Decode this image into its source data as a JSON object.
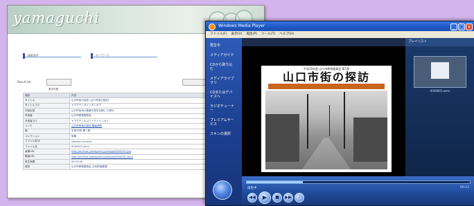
{
  "web_page": {
    "logo_text": "yamaguchi",
    "top_right_note": "データ検索",
    "field_a_label": "検索条件",
    "field_b_label": "キーワード",
    "list_label": "Result list",
    "select_value": "表示件数",
    "rows": [
      {
        "key": "項目",
        "value": "内容",
        "link": false
      },
      {
        "key": "タイトル",
        "value": "山口市街の採訪 (山口市街の探訪)",
        "link": false
      },
      {
        "key": "タイトルヨミ",
        "value": "ヤマグチシガイノタンボウ",
        "link": false
      },
      {
        "key": "内容記述",
        "value": "山口市街地の風景写真を収録した資料",
        "link": false
      },
      {
        "key": "作成者",
        "value": "山口市教育委員会",
        "link": false
      },
      {
        "key": "作成者ヨミ",
        "value": "ヤマグチシキョウイクイインカイ",
        "link": false
      },
      {
        "key": "リンク",
        "value": "山口市街地の探訪 動画資料",
        "link": true
      },
      {
        "key": "版",
        "value": "平成16年 第一版",
        "link": false
      },
      {
        "key": "コレクション",
        "value": "映像",
        "link": false
      },
      {
        "key": "ファイル形式",
        "value": "video/x-ms-wmv",
        "link": false
      },
      {
        "key": "ファイル名",
        "value": "0000001.wmv",
        "link": false
      },
      {
        "key": "画像URL",
        "value": "http://archive.yamaguchi.jp/image/0000001.jpg",
        "link": true
      },
      {
        "key": "動画URL",
        "value": "http://archive.yamaguchi.jp/movie/0000001.wmv",
        "link": true
      },
      {
        "key": "再生時間",
        "value": "00:15:00",
        "link": false
      },
      {
        "key": "提供",
        "value": "山口市教育委員会 文化財保護課",
        "link": false
      }
    ]
  },
  "media_player": {
    "window_title": "Windows Media Player",
    "menu": [
      "ファイル(F)",
      "表示(V)",
      "再生(P)",
      "ツール(T)",
      "ヘルプ(H)"
    ],
    "title_buttons": [
      "_",
      "□",
      "×"
    ],
    "nav_items": [
      "再生中",
      "メディアガイド",
      "CDから取り込む",
      "メディアライブラリ",
      "CDまたはデバイスへ",
      "ラジオチューナー",
      "プレミアムサービス",
      "スキンの選択"
    ],
    "now_playing_label": "プレイリスト",
    "poster_caption": "平成16年度 山口市教育委員会 第1巻",
    "poster_title": "山口市街の探訪",
    "thumb_caption": "0000001.wmv",
    "status_text": "再生中",
    "time_text": "00:12",
    "progress": 0.25,
    "controls": [
      "◀◀",
      "▶",
      "■",
      "▶▶",
      "♪"
    ]
  }
}
